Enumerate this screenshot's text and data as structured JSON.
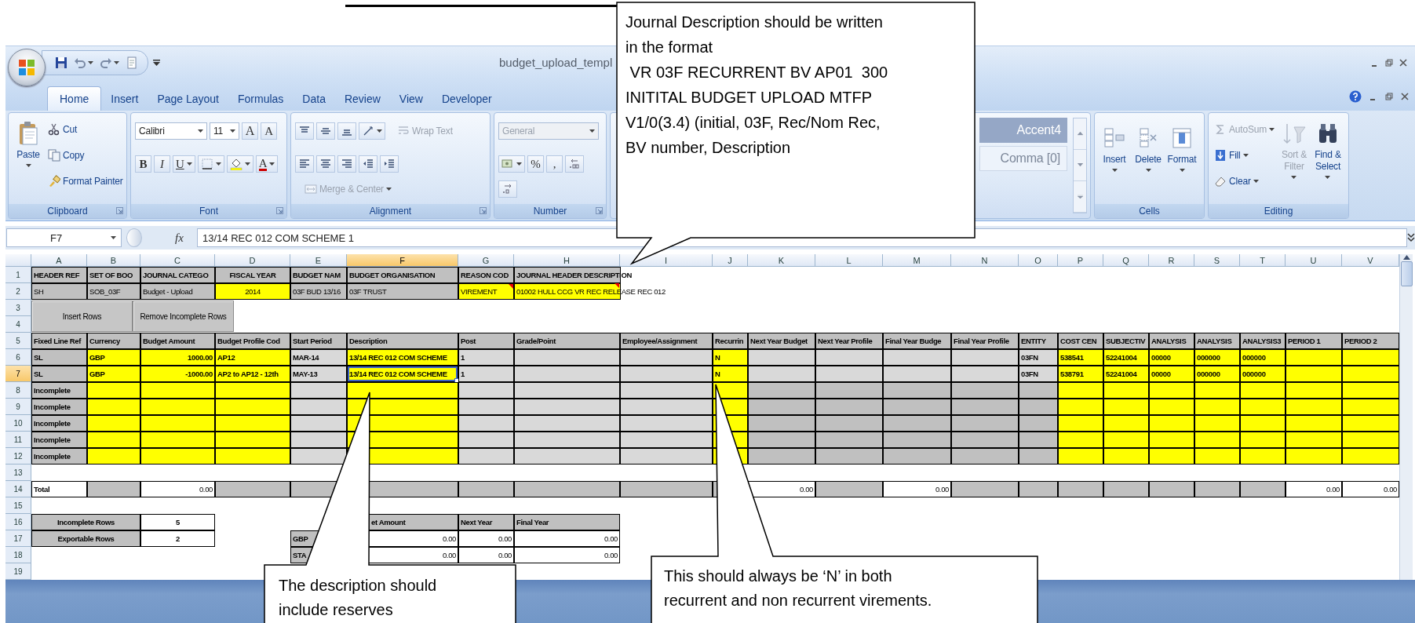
{
  "window": {
    "title": "budget_upload_templ"
  },
  "tabs": [
    {
      "label": "Home",
      "selected": true
    },
    {
      "label": "Insert",
      "selected": false
    },
    {
      "label": "Page Layout",
      "selected": false
    },
    {
      "label": "Formulas",
      "selected": false
    },
    {
      "label": "Data",
      "selected": false
    },
    {
      "label": "Review",
      "selected": false
    },
    {
      "label": "View",
      "selected": false
    },
    {
      "label": "Developer",
      "selected": false
    }
  ],
  "ribbon": {
    "groups": [
      {
        "label": "Clipboard",
        "launcher": true,
        "items": [
          {
            "kind": "paste",
            "label": "Paste",
            "disabled": false
          },
          {
            "kind": "cut",
            "label": "Cut",
            "disabled": false
          },
          {
            "kind": "copy",
            "label": "Copy",
            "disabled": false
          },
          {
            "kind": "painter",
            "label": "Format Painter",
            "disabled": false
          }
        ]
      },
      {
        "label": "Font",
        "launcher": true,
        "items": [
          {
            "kind": "fontname",
            "label": "Calibri",
            "disabled": false
          },
          {
            "kind": "fontsize",
            "label": "11",
            "disabled": false
          },
          {
            "kind": "grow",
            "label": "A",
            "disabled": false
          },
          {
            "kind": "shrink",
            "label": "A",
            "disabled": false
          },
          {
            "kind": "bold",
            "label": "B",
            "disabled": false
          },
          {
            "kind": "italic",
            "label": "I",
            "disabled": false
          },
          {
            "kind": "underline",
            "label": "U",
            "disabled": false
          },
          {
            "kind": "borders",
            "disabled": false
          },
          {
            "kind": "highlight",
            "disabled": false
          },
          {
            "kind": "fontcolor",
            "label": "A",
            "disabled": false
          }
        ]
      },
      {
        "label": "Alignment",
        "launcher": true,
        "items": [
          {
            "kind": "top",
            "disabled": false
          },
          {
            "kind": "middle",
            "disabled": false
          },
          {
            "kind": "bottom",
            "disabled": false
          },
          {
            "kind": "orient",
            "disabled": false
          },
          {
            "kind": "wrap",
            "label": "Wrap Text",
            "disabled": true
          },
          {
            "kind": "left",
            "disabled": false
          },
          {
            "kind": "center",
            "disabled": false
          },
          {
            "kind": "right",
            "disabled": false
          },
          {
            "kind": "outdent",
            "disabled": false
          },
          {
            "kind": "indent",
            "disabled": false
          },
          {
            "kind": "merge",
            "label": "Merge & Center",
            "disabled": true
          }
        ]
      },
      {
        "label": "Number",
        "launcher": true,
        "items": [
          {
            "kind": "format",
            "label": "General",
            "disabled": true
          },
          {
            "kind": "currency",
            "disabled": false
          },
          {
            "kind": "percent",
            "label": "%",
            "disabled": false
          },
          {
            "kind": "comma",
            "label": ",",
            "disabled": false
          },
          {
            "kind": "incdec",
            "disabled": false
          },
          {
            "kind": "decdec",
            "disabled": false
          }
        ]
      },
      {
        "launcher": false,
        "items": [
          {
            "kind": "style",
            "label": "Accent4",
            "color": "#95a7c6",
            "disabled": false
          },
          {
            "kind": "style",
            "label": "Comma [0]",
            "color": "#edf3fb",
            "disabled": false
          }
        ]
      },
      {
        "label": "Cells",
        "launcher": false,
        "items": [
          {
            "kind": "insert",
            "label": "Insert",
            "disabled": false
          },
          {
            "kind": "delete",
            "label": "Delete",
            "disabled": false
          },
          {
            "kind": "format2",
            "label": "Format",
            "disabled": false
          }
        ]
      },
      {
        "label": "Editing",
        "launcher": false,
        "items": [
          {
            "kind": "autosum",
            "label": "AutoSum",
            "disabled": true
          },
          {
            "kind": "fill",
            "label": "Fill",
            "disabled": false
          },
          {
            "kind": "clear",
            "label": "Clear",
            "disabled": false
          },
          {
            "kind": "sort",
            "label": "Sort & Filter",
            "disabled": true
          },
          {
            "kind": "find",
            "label": "Find & Select",
            "disabled": false
          }
        ]
      }
    ]
  },
  "formula_bar": {
    "name_box": "F7",
    "function_button": "fx",
    "value": "13/14 REC 012 COM SCHEME 1"
  },
  "sheet": {
    "columns": [
      {
        "label": "A",
        "selected": false
      },
      {
        "label": "B",
        "selected": false
      },
      {
        "label": "C",
        "selected": false
      },
      {
        "label": "D",
        "selected": false
      },
      {
        "label": "E",
        "selected": false
      },
      {
        "label": "F",
        "selected": true
      },
      {
        "label": "G",
        "selected": false
      },
      {
        "label": "H",
        "selected": false
      },
      {
        "label": "I",
        "selected": false
      },
      {
        "label": "J",
        "selected": false
      },
      {
        "label": "K",
        "selected": false
      },
      {
        "label": "L",
        "selected": false
      },
      {
        "label": "M",
        "selected": false
      },
      {
        "label": "N",
        "selected": false
      },
      {
        "label": "O",
        "selected": false
      },
      {
        "label": "P",
        "selected": false
      },
      {
        "label": "Q",
        "selected": false
      },
      {
        "label": "R",
        "selected": false
      },
      {
        "label": "S",
        "selected": false
      },
      {
        "label": "T",
        "selected": false
      },
      {
        "label": "U",
        "selected": false
      },
      {
        "label": "V",
        "selected": false
      }
    ],
    "rows": [
      {
        "number": "1",
        "selected": false,
        "cells": [
          {
            "kind": "header",
            "text": "HEADER REF"
          },
          {
            "kind": "header",
            "text": "SET OF BOO"
          },
          {
            "kind": "header",
            "text": "JOURNAL CATEGO"
          },
          {
            "kind": "headc",
            "text": "FISCAL YEAR"
          },
          {
            "kind": "header",
            "text": "BUDGET NAM"
          },
          {
            "kind": "header",
            "text": "BUDGET ORGANISATION"
          },
          {
            "kind": "header",
            "text": "REASON COD"
          },
          {
            "kind": "spill",
            "text": "JOURNAL HEADER DESCRIPTION"
          }
        ]
      },
      {
        "number": "2",
        "selected": false,
        "cells": [
          {
            "kind": "grey",
            "text": "SH"
          },
          {
            "kind": "grey",
            "text": "SOB_03F"
          },
          {
            "kind": "grey",
            "text": "Budget - Upload"
          },
          {
            "kind": "year",
            "text": "2014"
          },
          {
            "kind": "grey",
            "text": "03F BUD 13/16"
          },
          {
            "kind": "grey",
            "text": "03F TRUST"
          },
          {
            "kind": "note",
            "text": "VIREMENT"
          },
          {
            "kind": "notespill",
            "text": "01002 HULL CCG VR REC RELEASE REC 012"
          }
        ]
      },
      {
        "number": "3",
        "selected": false,
        "buttons": [
          {
            "label": "Insert Rows"
          },
          {
            "label": "Remove Incomplete Rows"
          }
        ]
      },
      {
        "number": "4",
        "selected": false
      },
      {
        "number": "5",
        "selected": false,
        "cells": [
          {
            "kind": "header",
            "text": "Fixed Line Ref"
          },
          {
            "kind": "header",
            "text": "Currency"
          },
          {
            "kind": "header",
            "text": "Budget Amount"
          },
          {
            "kind": "header",
            "text": "Budget Profile Cod"
          },
          {
            "kind": "header",
            "text": "Start Period"
          },
          {
            "kind": "header",
            "text": "Description"
          },
          {
            "kind": "header",
            "text": "Post"
          },
          {
            "kind": "header",
            "text": "Grade/Point"
          },
          {
            "kind": "header",
            "text": "Employee/Assignment"
          },
          {
            "kind": "header",
            "text": "Recurrin"
          },
          {
            "kind": "header",
            "text": "Next Year Budget"
          },
          {
            "kind": "header",
            "text": "Next Year Profile"
          },
          {
            "kind": "header",
            "text": "Final Year Budge"
          },
          {
            "kind": "header",
            "text": "Final Year Profile"
          },
          {
            "kind": "header",
            "text": "ENTITY"
          },
          {
            "kind": "header",
            "text": "COST CEN"
          },
          {
            "kind": "header",
            "text": "SUBJECTIV"
          },
          {
            "kind": "header",
            "text": "ANALYSIS"
          },
          {
            "kind": "header",
            "text": "ANALYSIS"
          },
          {
            "kind": "header",
            "text": "ANALYSIS3"
          },
          {
            "kind": "header",
            "text": "PERIOD 1"
          },
          {
            "kind": "header",
            "text": "PERIOD 2"
          }
        ]
      },
      {
        "number": "6",
        "selected": false,
        "cells": [
          {
            "kind": "key",
            "text": "SL"
          },
          {
            "kind": "input",
            "text": "GBP"
          },
          {
            "kind": "amount",
            "text": "1000.00"
          },
          {
            "kind": "input",
            "text": "AP12"
          },
          {
            "kind": "light",
            "text": "MAR-14"
          },
          {
            "kind": "input",
            "text": "13/14 REC 012 COM SCHEME"
          },
          {
            "kind": "light",
            "text": "1"
          },
          {
            "kind": "light"
          },
          {
            "kind": "light"
          },
          {
            "kind": "input",
            "text": "N"
          },
          {
            "kind": "light"
          },
          {
            "kind": "light"
          },
          {
            "kind": "light"
          },
          {
            "kind": "light"
          },
          {
            "kind": "light",
            "text": "03FN"
          },
          {
            "kind": "input",
            "text": "538541"
          },
          {
            "kind": "input",
            "text": "52241004"
          },
          {
            "kind": "input",
            "text": "00000"
          },
          {
            "kind": "input",
            "text": "000000"
          },
          {
            "kind": "input",
            "text": "000000"
          },
          {
            "kind": "input"
          },
          {
            "kind": "input"
          }
        ]
      },
      {
        "number": "7",
        "selected": true,
        "cells": [
          {
            "kind": "key",
            "text": "SL"
          },
          {
            "kind": "input",
            "text": "GBP"
          },
          {
            "kind": "amount",
            "text": "-1000.00"
          },
          {
            "kind": "input",
            "text": "AP2 to AP12 - 12th"
          },
          {
            "kind": "light",
            "text": "MAY-13"
          },
          {
            "kind": "picked",
            "text": "13/14 REC 012 COM SCHEME"
          },
          {
            "kind": "light",
            "text": "1"
          },
          {
            "kind": "light"
          },
          {
            "kind": "light"
          },
          {
            "kind": "input",
            "text": "N"
          },
          {
            "kind": "light"
          },
          {
            "kind": "light"
          },
          {
            "kind": "light"
          },
          {
            "kind": "light"
          },
          {
            "kind": "light",
            "text": "03FN"
          },
          {
            "kind": "input",
            "text": "538791"
          },
          {
            "kind": "input",
            "text": "52241004"
          },
          {
            "kind": "input",
            "text": "00000"
          },
          {
            "kind": "input",
            "text": "000000"
          },
          {
            "kind": "input",
            "text": "000000"
          },
          {
            "kind": "input"
          },
          {
            "kind": "input"
          }
        ]
      },
      {
        "number": "8",
        "selected": false,
        "cells": [
          {
            "kind": "key",
            "text": "Incomplete"
          },
          {
            "kind": "input"
          },
          {
            "kind": "input"
          },
          {
            "kind": "input"
          },
          {
            "kind": "light"
          },
          {
            "kind": "input"
          },
          {
            "kind": "light"
          },
          {
            "kind": "light"
          },
          {
            "kind": "light"
          },
          {
            "kind": "input"
          },
          {
            "kind": "grey"
          },
          {
            "kind": "grey"
          },
          {
            "kind": "grey"
          },
          {
            "kind": "grey"
          },
          {
            "kind": "grey"
          },
          {
            "kind": "input"
          },
          {
            "kind": "input"
          },
          {
            "kind": "input"
          },
          {
            "kind": "input"
          },
          {
            "kind": "input"
          },
          {
            "kind": "input"
          },
          {
            "kind": "input"
          }
        ]
      },
      {
        "number": "9",
        "selected": false,
        "cells": [
          {
            "kind": "key",
            "text": "Incomplete"
          },
          {
            "kind": "input"
          },
          {
            "kind": "input"
          },
          {
            "kind": "input"
          },
          {
            "kind": "light"
          },
          {
            "kind": "input"
          },
          {
            "kind": "light"
          },
          {
            "kind": "light"
          },
          {
            "kind": "light"
          },
          {
            "kind": "input"
          },
          {
            "kind": "grey"
          },
          {
            "kind": "grey"
          },
          {
            "kind": "grey"
          },
          {
            "kind": "grey"
          },
          {
            "kind": "grey"
          },
          {
            "kind": "input"
          },
          {
            "kind": "input"
          },
          {
            "kind": "input"
          },
          {
            "kind": "input"
          },
          {
            "kind": "input"
          },
          {
            "kind": "input"
          },
          {
            "kind": "input"
          }
        ]
      },
      {
        "number": "10",
        "selected": false,
        "cells": [
          {
            "kind": "key",
            "text": "Incomplete"
          },
          {
            "kind": "input"
          },
          {
            "kind": "input"
          },
          {
            "kind": "input"
          },
          {
            "kind": "light"
          },
          {
            "kind": "input"
          },
          {
            "kind": "light"
          },
          {
            "kind": "light"
          },
          {
            "kind": "light"
          },
          {
            "kind": "input"
          },
          {
            "kind": "grey"
          },
          {
            "kind": "grey"
          },
          {
            "kind": "grey"
          },
          {
            "kind": "grey"
          },
          {
            "kind": "grey"
          },
          {
            "kind": "input"
          },
          {
            "kind": "input"
          },
          {
            "kind": "input"
          },
          {
            "kind": "input"
          },
          {
            "kind": "input"
          },
          {
            "kind": "input"
          },
          {
            "kind": "input"
          }
        ]
      },
      {
        "number": "11",
        "selected": false,
        "cells": [
          {
            "kind": "key",
            "text": "Incomplete"
          },
          {
            "kind": "input"
          },
          {
            "kind": "input"
          },
          {
            "kind": "input"
          },
          {
            "kind": "light"
          },
          {
            "kind": "input"
          },
          {
            "kind": "light"
          },
          {
            "kind": "light"
          },
          {
            "kind": "light"
          },
          {
            "kind": "input"
          },
          {
            "kind": "grey"
          },
          {
            "kind": "grey"
          },
          {
            "kind": "grey"
          },
          {
            "kind": "grey"
          },
          {
            "kind": "grey"
          },
          {
            "kind": "input"
          },
          {
            "kind": "input"
          },
          {
            "kind": "input"
          },
          {
            "kind": "input"
          },
          {
            "kind": "input"
          },
          {
            "kind": "input"
          },
          {
            "kind": "input"
          }
        ]
      },
      {
        "number": "12",
        "selected": false,
        "cells": [
          {
            "kind": "key",
            "text": "Incomplete"
          },
          {
            "kind": "input"
          },
          {
            "kind": "input"
          },
          {
            "kind": "input"
          },
          {
            "kind": "light"
          },
          {
            "kind": "input"
          },
          {
            "kind": "light"
          },
          {
            "kind": "light"
          },
          {
            "kind": "light"
          },
          {
            "kind": "input"
          },
          {
            "kind": "grey"
          },
          {
            "kind": "grey"
          },
          {
            "kind": "grey"
          },
          {
            "kind": "grey"
          },
          {
            "kind": "grey"
          },
          {
            "kind": "input"
          },
          {
            "kind": "input"
          },
          {
            "kind": "input"
          },
          {
            "kind": "input"
          },
          {
            "kind": "input"
          },
          {
            "kind": "input"
          },
          {
            "kind": "input"
          }
        ]
      },
      {
        "number": "13",
        "selected": false
      },
      {
        "number": "14",
        "selected": false,
        "cells": [
          {
            "kind": "summary",
            "text": "Total"
          },
          {
            "kind": "grey"
          },
          {
            "kind": "sum",
            "text": "0.00"
          },
          {
            "kind": "grey"
          },
          {
            "kind": "grey"
          },
          {
            "kind": "grey"
          },
          {
            "kind": "grey"
          },
          {
            "kind": "grey"
          },
          {
            "kind": "grey"
          },
          {
            "kind": "grey"
          },
          {
            "kind": "sum",
            "text": "0.00"
          },
          {
            "kind": "grey"
          },
          {
            "kind": "sum",
            "text": "0.00"
          },
          {
            "kind": "grey"
          },
          {
            "kind": "grey"
          },
          {
            "kind": "grey"
          },
          {
            "kind": "grey"
          },
          {
            "kind": "grey"
          },
          {
            "kind": "grey"
          },
          {
            "kind": "grey"
          },
          {
            "kind": "sum",
            "text": "0.00"
          },
          {
            "kind": "sum",
            "text": "0.00"
          }
        ]
      },
      {
        "number": "15",
        "selected": false
      },
      {
        "number": "16",
        "selected": false,
        "cells": [
          {
            "kind": "label",
            "text": "Incomplete Rows"
          },
          {
            "kind": "count",
            "text": "5"
          },
          {
            "kind": "none"
          },
          {
            "kind": "none"
          },
          {
            "kind": "cut",
            "text": "et Amount"
          },
          {
            "kind": "header",
            "text": "Next Year"
          },
          {
            "kind": "header",
            "text": "Final Year"
          }
        ]
      },
      {
        "number": "17",
        "selected": false,
        "cells": [
          {
            "kind": "label",
            "text": "Exportable Rows"
          },
          {
            "kind": "count",
            "text": "2"
          },
          {
            "kind": "none"
          },
          {
            "kind": "key",
            "text": "GBP"
          },
          {
            "kind": "sum",
            "text": "0.00"
          },
          {
            "kind": "sum",
            "text": "0.00"
          },
          {
            "kind": "sum",
            "text": "0.00"
          }
        ]
      },
      {
        "number": "18",
        "selected": false,
        "cells": [
          {
            "kind": "none"
          },
          {
            "kind": "none"
          },
          {
            "kind": "none"
          },
          {
            "kind": "none"
          },
          {
            "kind": "key",
            "text": "STA"
          },
          {
            "kind": "sum",
            "text": "0.00"
          },
          {
            "kind": "sum",
            "text": "0.00"
          },
          {
            "kind": "sum",
            "text": "0.00"
          }
        ]
      },
      {
        "number": "19",
        "selected": false
      }
    ]
  },
  "callouts": [
    {
      "text": "Journal Description should be written\nin the format\n VR 03F RECURRENT BV AP01  300\nINITITAL BUDGET UPLOAD MTFP\nV1/0(3.4) (initial, 03F, Rec/Nom Rec,\nBV number, Description"
    },
    {
      "text": "The description should\ninclude reserves"
    },
    {
      "text": "This should always be ‘N’ in both\nrecurrent and non recurrent virements."
    }
  ]
}
